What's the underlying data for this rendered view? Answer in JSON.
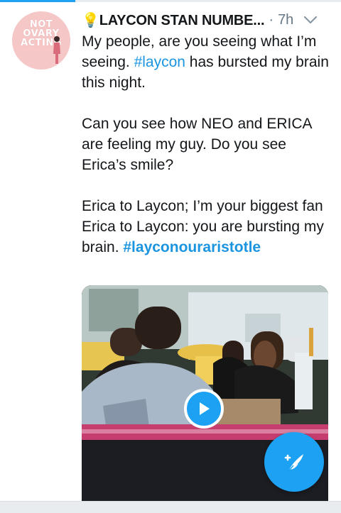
{
  "progress": {
    "fraction": 0.22,
    "color": "#1da1f2"
  },
  "avatar": {
    "line1": "NOT",
    "line2": "OVARY",
    "line3": "ACTING"
  },
  "header": {
    "author": "💡LAYCON STAN NUMBE...",
    "separator": "·",
    "time": "7h",
    "menu_icon": "chevron-down-icon"
  },
  "tweet": {
    "p1_a": "My people, are you seeing what I’m seeing. ",
    "p1_hashtag": "#laycon",
    "p1_b": " has bursted my brain this night.",
    "p2": "Can you see how NEO and ERICA are feeling my guy. Do you see Erica’s smile?",
    "p3_l1": "Erica to Laycon; I’m your biggest fan",
    "p3_l2_a": "Erica to Laycon: you are bursting my brain. ",
    "p3_hashtag": "#layconouraristotle"
  },
  "media": {
    "type": "video",
    "play_icon": "play-icon"
  },
  "fab": {
    "icon": "compose-feather-icon"
  },
  "colors": {
    "accent": "#1da1f2",
    "hashtag": "#1b95e0",
    "text": "#14171a",
    "muted": "#657786"
  }
}
